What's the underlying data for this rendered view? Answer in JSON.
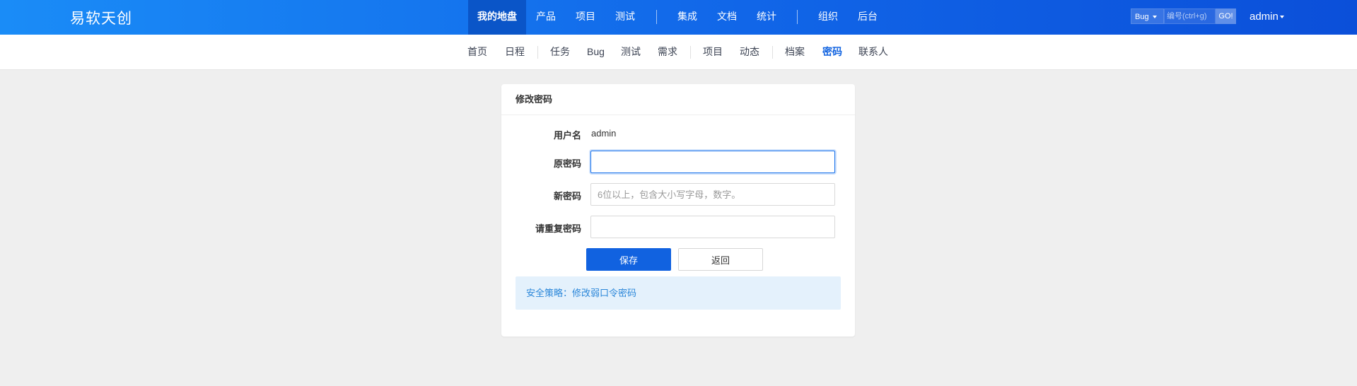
{
  "brand": "易软天创",
  "main_nav": {
    "items": [
      {
        "label": "我的地盘",
        "active": true
      },
      {
        "label": "产品"
      },
      {
        "label": "项目"
      },
      {
        "label": "测试"
      },
      {
        "label": "集成"
      },
      {
        "label": "文档"
      },
      {
        "label": "统计"
      },
      {
        "label": "组织"
      },
      {
        "label": "后台"
      }
    ]
  },
  "search": {
    "type": "Bug",
    "placeholder": "编号(ctrl+g)",
    "go_label": "GO!"
  },
  "user": {
    "name": "admin"
  },
  "sub_nav": {
    "items": [
      {
        "label": "首页"
      },
      {
        "label": "日程"
      },
      {
        "label": "任务"
      },
      {
        "label": "Bug"
      },
      {
        "label": "测试"
      },
      {
        "label": "需求"
      },
      {
        "label": "项目"
      },
      {
        "label": "动态"
      },
      {
        "label": "档案"
      },
      {
        "label": "密码",
        "active": true
      },
      {
        "label": "联系人"
      }
    ]
  },
  "form": {
    "title": "修改密码",
    "username_label": "用户名",
    "username_value": "admin",
    "old_password_label": "原密码",
    "old_password_value": "",
    "new_password_label": "新密码",
    "new_password_placeholder": "6位以上，包含大小写字母，数字。",
    "repeat_password_label": "请重复密码",
    "save_label": "保存",
    "back_label": "返回",
    "policy_text": "安全策略：修改弱口令密码"
  },
  "colors": {
    "header_start": "#1a8cf7",
    "header_end": "#0b4fd9",
    "primary": "#1162e0",
    "policy_bg": "#e4f1fc",
    "policy_text": "#2a86d9"
  }
}
